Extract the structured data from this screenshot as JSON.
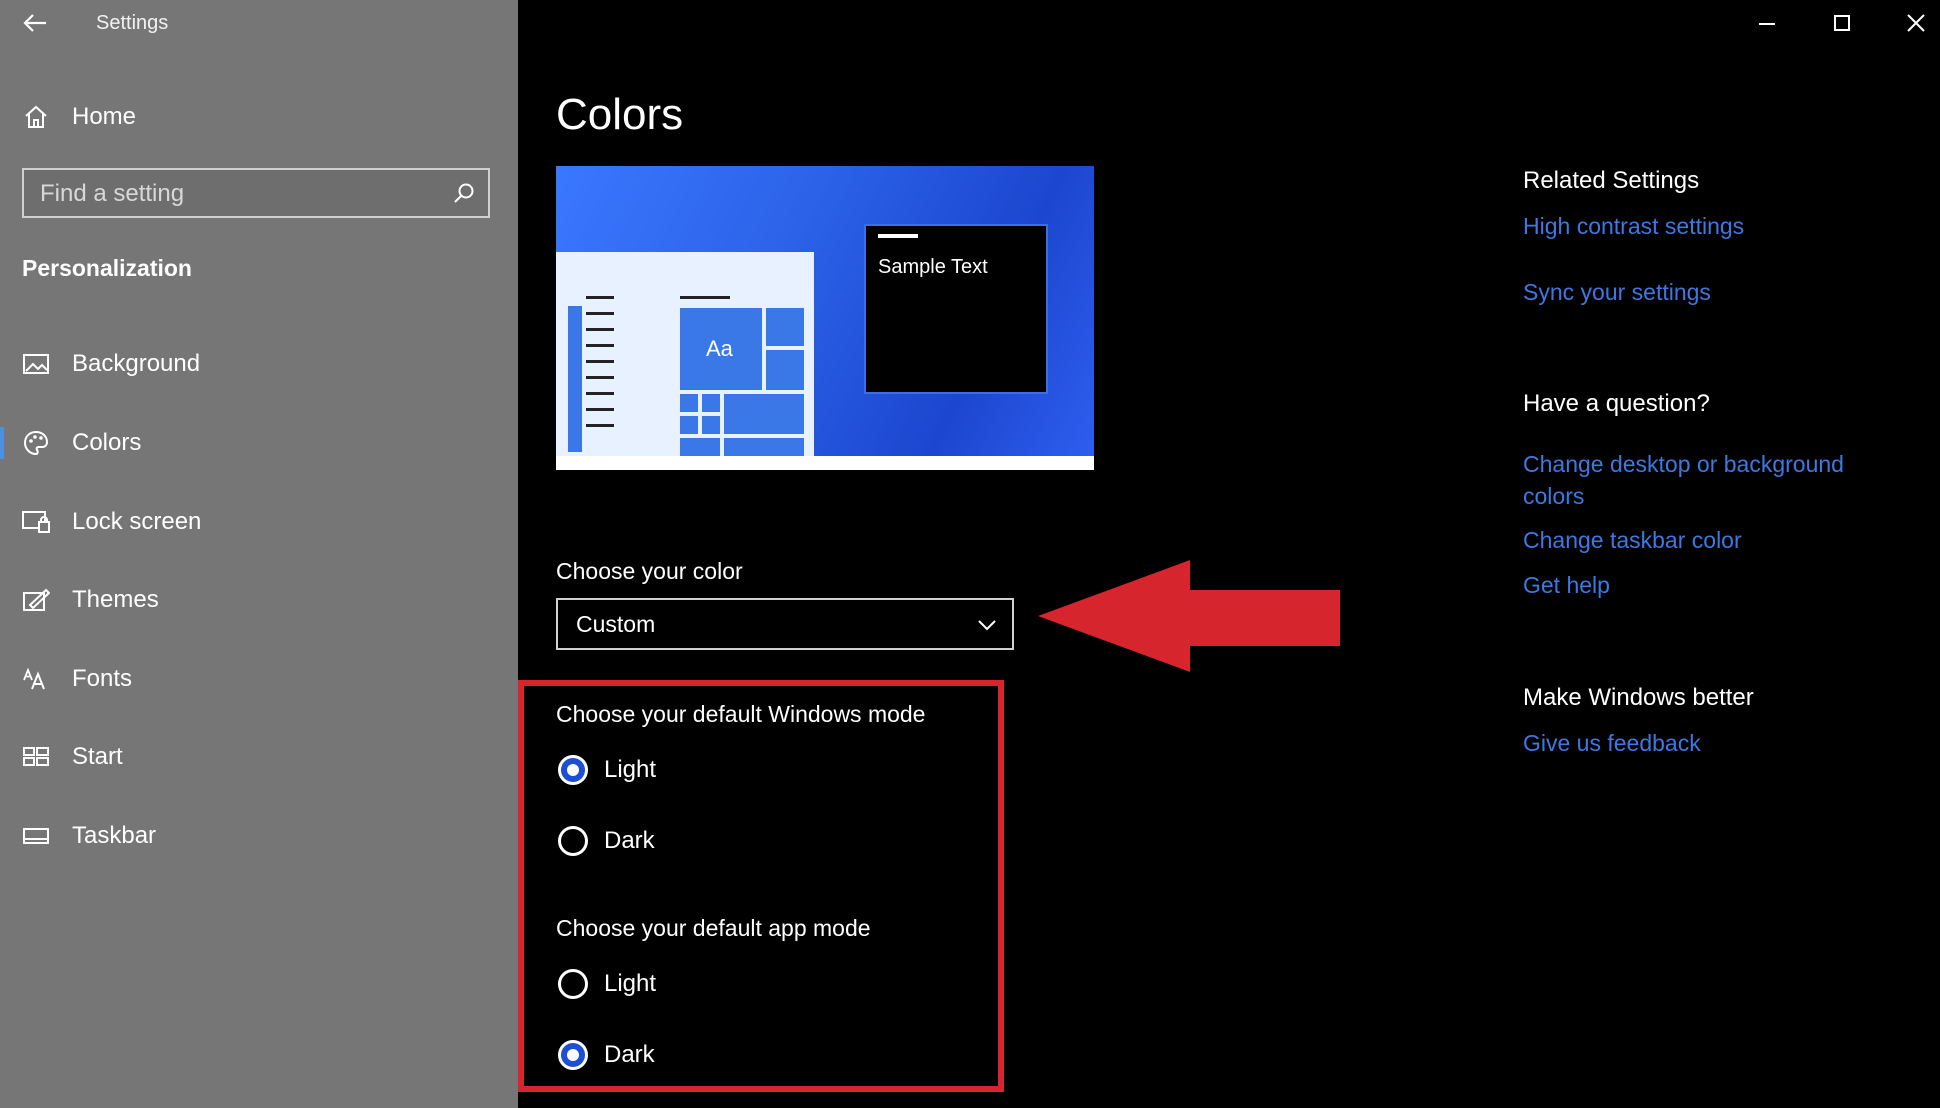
{
  "window": {
    "title": "Settings"
  },
  "sidebar": {
    "home_label": "Home",
    "search_placeholder": "Find a setting",
    "section_title": "Personalization",
    "items": [
      {
        "label": "Background",
        "icon": "image-icon"
      },
      {
        "label": "Colors",
        "icon": "palette-icon",
        "active": true
      },
      {
        "label": "Lock screen",
        "icon": "lock-screen-icon"
      },
      {
        "label": "Themes",
        "icon": "themes-icon"
      },
      {
        "label": "Fonts",
        "icon": "fonts-icon"
      },
      {
        "label": "Start",
        "icon": "start-icon"
      },
      {
        "label": "Taskbar",
        "icon": "taskbar-icon"
      }
    ]
  },
  "main": {
    "title": "Colors",
    "preview": {
      "sample_text": "Sample Text",
      "tile_text": "Aa"
    },
    "choose_color": {
      "label": "Choose your color",
      "value": "Custom"
    },
    "windows_mode": {
      "label": "Choose your default Windows mode",
      "options": [
        "Light",
        "Dark"
      ],
      "selected": "Light"
    },
    "app_mode": {
      "label": "Choose your default app mode",
      "options": [
        "Light",
        "Dark"
      ],
      "selected": "Dark"
    }
  },
  "related": {
    "heading": "Related Settings",
    "links": [
      "High contrast settings",
      "Sync your settings"
    ],
    "question_heading": "Have a question?",
    "question_links": [
      "Change desktop or background colors",
      "Change taskbar color",
      "Get help"
    ],
    "better_heading": "Make Windows better",
    "better_links": [
      "Give us feedback"
    ]
  },
  "colors": {
    "sidebar_bg": "#767676",
    "main_bg": "#000000",
    "accent": "#3d78e3",
    "highlight": "#d6252c"
  }
}
